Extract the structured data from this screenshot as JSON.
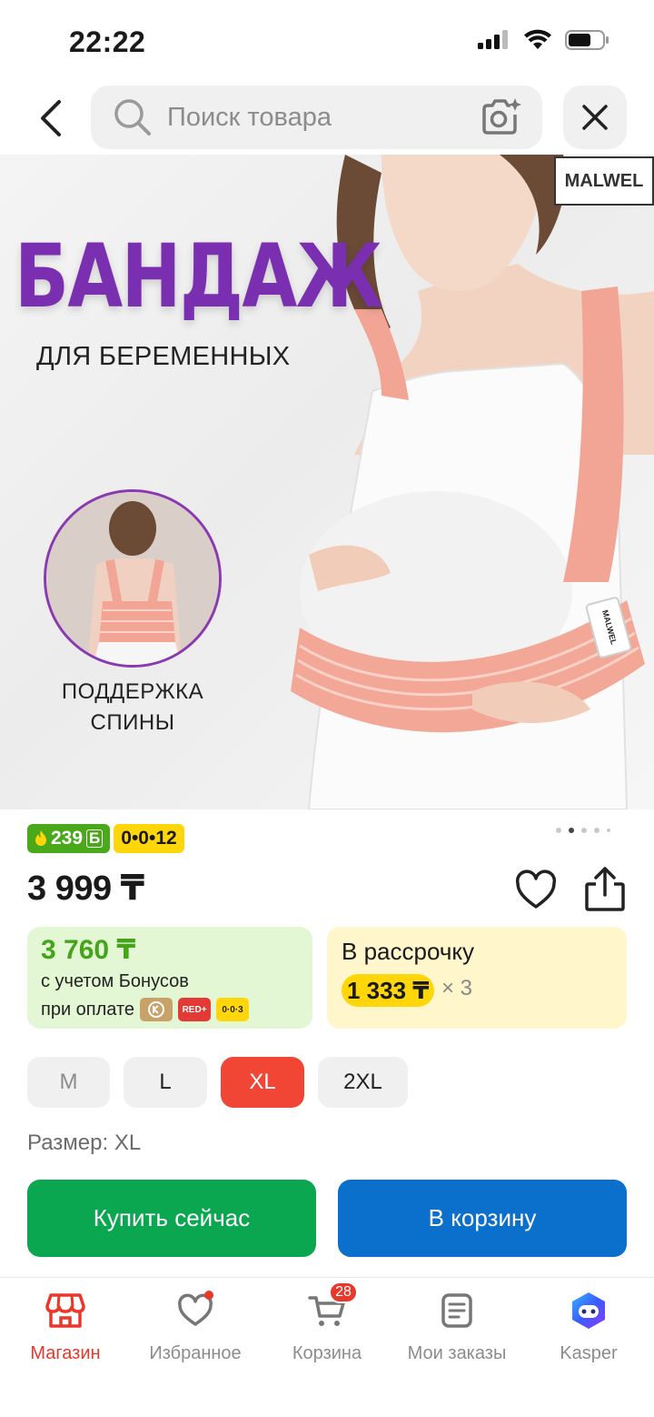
{
  "status_bar": {
    "time": "22:22"
  },
  "search": {
    "placeholder": "Поиск товара"
  },
  "product_image": {
    "title": "БАНДАЖ",
    "subtitle": "ДЛЯ БЕРЕМЕННЫХ",
    "brand_logo": "MALWEL",
    "back_support_label": "ПОДДЕРЖКА СПИНЫ",
    "hang_tag": "MALWEL"
  },
  "badges": {
    "bonus": "239",
    "bonus_unit": "Б",
    "credit": "0•0•12"
  },
  "price": "3 999 ₸",
  "bonus_offer": {
    "price": "3 760 ₸",
    "note": "с учетом Бонусов",
    "pay_label": "при оплате",
    "chips": {
      "red": "RED+",
      "zero": "0·0·3"
    }
  },
  "installment": {
    "title": "В рассрочку",
    "amount": "1 333 ₸",
    "times": "× 3"
  },
  "sizes": [
    {
      "label": "M",
      "state": "disabled"
    },
    {
      "label": "L",
      "state": "available"
    },
    {
      "label": "XL",
      "state": "selected"
    },
    {
      "label": "2XL",
      "state": "available"
    }
  ],
  "size_label": "Размер: XL",
  "actions": {
    "buy_now": "Купить сейчас",
    "add_to_cart": "В корзину"
  },
  "bottom_nav": {
    "items": [
      {
        "label": "Магазин",
        "icon": "store-icon",
        "active": true
      },
      {
        "label": "Избранное",
        "icon": "heart-icon"
      },
      {
        "label": "Корзина",
        "icon": "cart-icon",
        "badge": "28"
      },
      {
        "label": "Мои заказы",
        "icon": "orders-icon"
      },
      {
        "label": "Kasper",
        "icon": "kasper-icon"
      }
    ]
  },
  "colors": {
    "accent_red": "#f14635",
    "buy_green": "#0aa650",
    "cart_blue": "#0b6fcc",
    "bonus_green": "#45a41b",
    "credit_yellow": "#ffd60a",
    "banner_purple": "#7a2fb0"
  }
}
